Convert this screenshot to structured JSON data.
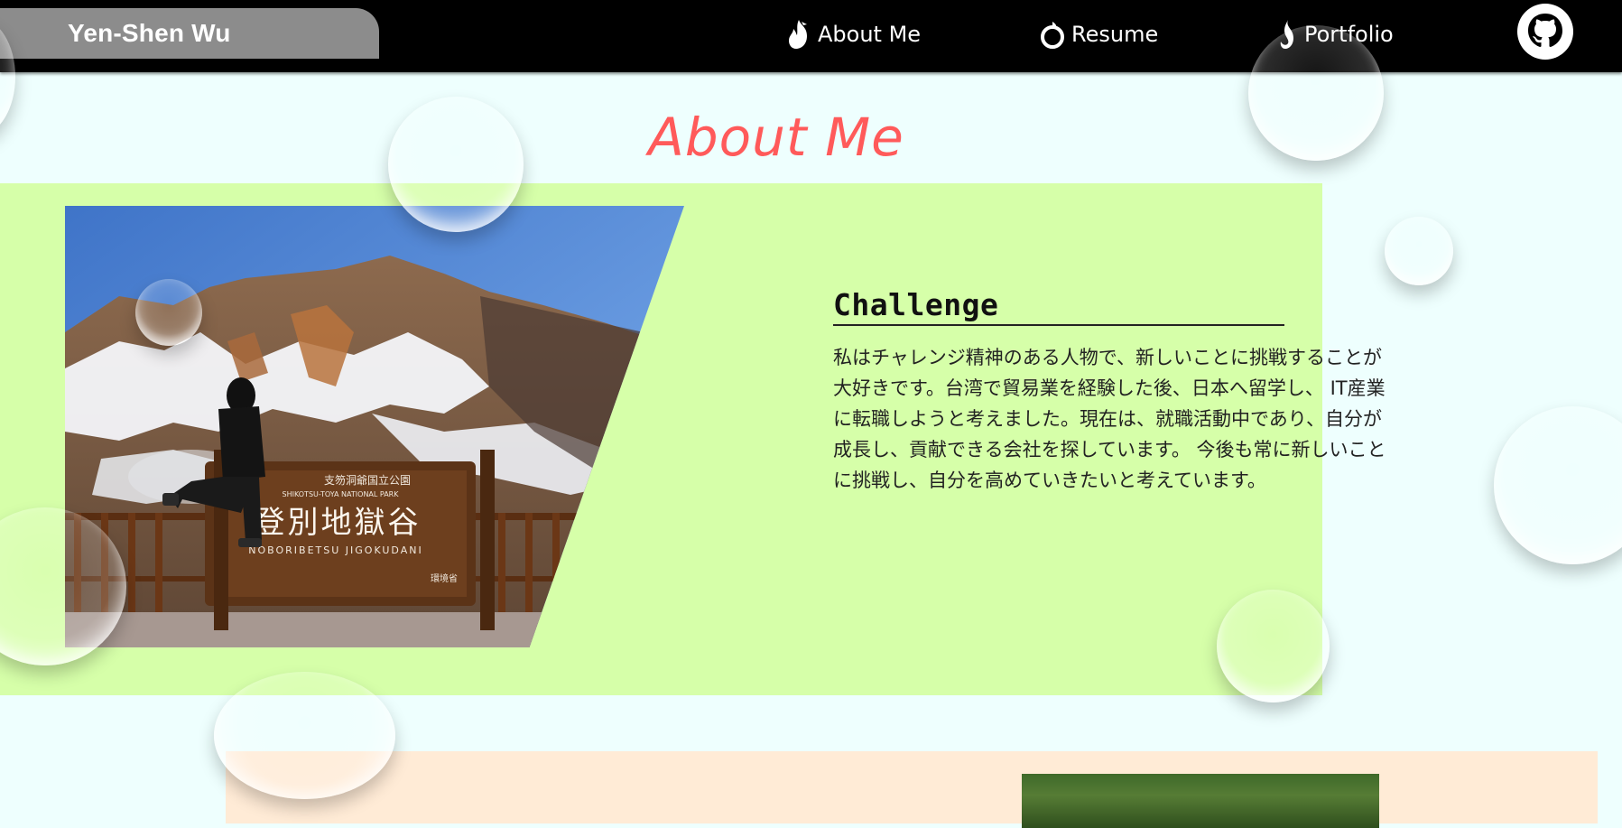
{
  "header": {
    "brand": "Yen-Shen Wu",
    "nav": [
      {
        "label": "About Me",
        "icon": "flame-icon"
      },
      {
        "label": "Resume",
        "icon": "ring-icon"
      },
      {
        "label": "Portfolio",
        "icon": "fire-swirl-icon"
      }
    ],
    "github_icon": "github-icon"
  },
  "about": {
    "title": "About Me",
    "card": {
      "heading": "Challenge",
      "body": "私はチャレンジ精神のある人物で、新しいことに挑戦することが大好きです。台湾で貿易業を経験した後、日本へ留学し、 IT産業に転職しようと考えました。現在は、就職活動中であり、自分が成長し、貢献できる会社を探しています。 今後も常に新しいことに挑戦し、自分を高めていきたいと考えています。"
    },
    "photo": {
      "sign_main": "登別地獄谷",
      "sign_top": "支笏洞爺国立公園",
      "sign_en_top": "SHIKOTSU-TOYA NATIONAL PARK",
      "sign_en": "NOBORIBETSU JIGOKUDANI",
      "sign_small": "環境省"
    }
  },
  "colors": {
    "page_bg": "#eefffe",
    "header_bg": "#000000",
    "brand_bg": "#8c8c8c",
    "title": "#ff5a5a",
    "about_panel": "#d6ffa9",
    "next_panel": "#ffebd6"
  }
}
